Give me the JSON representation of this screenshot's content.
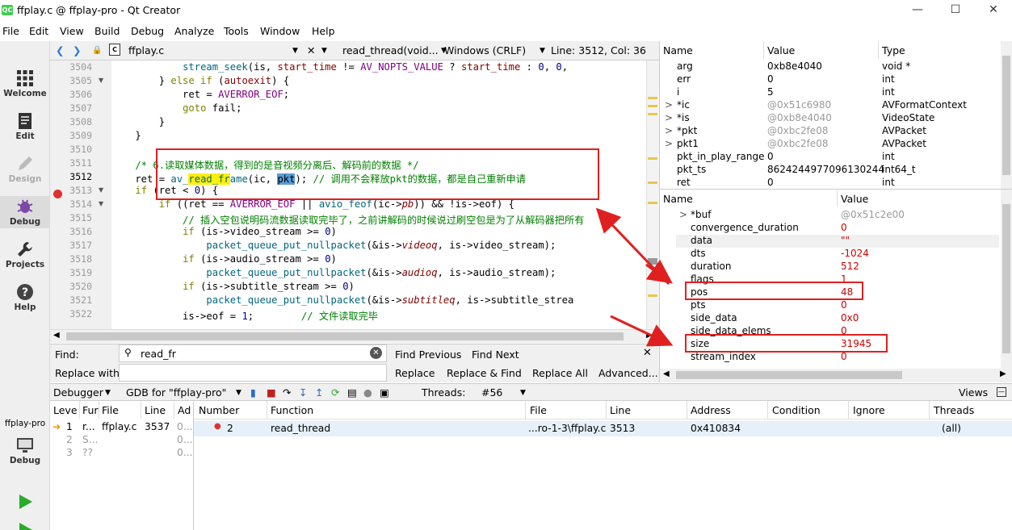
{
  "window": {
    "title": "ffplay.c @ ffplay-pro - Qt Creator",
    "logo": "QC"
  },
  "menu": [
    "File",
    "Edit",
    "View",
    "Build",
    "Debug",
    "Analyze",
    "Tools",
    "Window",
    "Help"
  ],
  "modes": [
    {
      "label": "Welcome",
      "icon": "welcome-grid-icon"
    },
    {
      "label": "Edit",
      "icon": "edit-document-icon"
    },
    {
      "label": "Design",
      "icon": "design-pen-icon"
    },
    {
      "label": "Debug",
      "icon": "debug-bug-icon"
    },
    {
      "label": "Projects",
      "icon": "wrench-icon"
    },
    {
      "label": "Help",
      "icon": "help-question-icon"
    }
  ],
  "kit": {
    "project": "ffplay-pro",
    "label": "Debug"
  },
  "editor": {
    "file": "ffplay.c",
    "function": "read_thread(void...",
    "line_ending": "Windows (CRLF)",
    "position": "Line: 3512, Col: 36"
  },
  "code": [
    {
      "n": "3504",
      "t": "            stream_seek(is, start_time != AV_NOPTS_VALUE ? start_time : 0, 0,"
    },
    {
      "n": "3505",
      "t": "        } else if (autoexit) {"
    },
    {
      "n": "3506",
      "t": "            ret = AVERROR_EOF;"
    },
    {
      "n": "3507",
      "t": "            goto fail;"
    },
    {
      "n": "3508",
      "t": "        }"
    },
    {
      "n": "3509",
      "t": "    }"
    },
    {
      "n": "3510",
      "t": ""
    },
    {
      "n": "3511",
      "t": "    /* 6.读取媒体数据，得到的是音视频分离后、解码前的数据 */"
    },
    {
      "n": "3512",
      "t": "    ret = av_read_frame(ic, pkt); // 调用不会释放pkt的数据，都是自己重新申请"
    },
    {
      "n": "3513",
      "t": "    if (ret < 0) {"
    },
    {
      "n": "3514",
      "t": "        if ((ret == AVERROR_EOF || avio_feof(ic->pb)) && !is->eof) {"
    },
    {
      "n": "3515",
      "t": "            // 插入空包说明码流数据读取完毕了，之前讲解码的时候说过刷空包是为了从解码器把所有"
    },
    {
      "n": "3516",
      "t": "            if (is->video_stream >= 0)"
    },
    {
      "n": "3517",
      "t": "                packet_queue_put_nullpacket(&is->videoq, is->video_stream);"
    },
    {
      "n": "3518",
      "t": "            if (is->audio_stream >= 0)"
    },
    {
      "n": "3519",
      "t": "                packet_queue_put_nullpacket(&is->audioq, is->audio_stream);"
    },
    {
      "n": "3520",
      "t": "            if (is->subtitle_stream >= 0)"
    },
    {
      "n": "3521",
      "t": "                packet_queue_put_nullpacket(&is->subtitleq, is->subtitle_strea"
    },
    {
      "n": "3522",
      "t": "            is->eof = 1;        // 文件读取完毕"
    }
  ],
  "find": {
    "find_label": "Find:",
    "find_value": "read_fr",
    "replace_label": "Replace with:",
    "replace_value": "",
    "find_previous": "Find Previous",
    "find_next": "Find Next",
    "replace": "Replace",
    "replace_find": "Replace & Find",
    "replace_all": "Replace All",
    "advanced": "Advanced..."
  },
  "locals_headers": [
    "Name",
    "Value",
    "Type"
  ],
  "locals": [
    {
      "name": "arg",
      "value": "0xb8e4040",
      "type": "void *",
      "exp": ""
    },
    {
      "name": "err",
      "value": "0",
      "type": "int",
      "exp": ""
    },
    {
      "name": "i",
      "value": "5",
      "type": "int",
      "exp": ""
    },
    {
      "name": "*ic",
      "value": "@0x51c6980",
      "type": "AVFormatContext",
      "exp": ">"
    },
    {
      "name": "*is",
      "value": "@0xb8e4040",
      "type": "VideoState",
      "exp": ">"
    },
    {
      "name": "*pkt",
      "value": "@0xbc2fe08",
      "type": "AVPacket",
      "exp": ">"
    },
    {
      "name": "pkt1",
      "value": "@0xbc2fe08",
      "type": "AVPacket",
      "exp": ">"
    },
    {
      "name": "pkt_in_play_range",
      "value": "0",
      "type": "int",
      "exp": ""
    },
    {
      "name": "pkt_ts",
      "value": "8624244977096130244",
      "type": "int64_t",
      "exp": ""
    },
    {
      "name": "ret",
      "value": "0",
      "type": "int",
      "exp": ""
    }
  ],
  "expr_headers": [
    "Name",
    "Value"
  ],
  "expr": [
    {
      "name": "*buf",
      "value": "@0x51c2e00",
      "exp": ">"
    },
    {
      "name": "convergence_duration",
      "value": "0",
      "exp": ""
    },
    {
      "name": "data",
      "value": "\"\"",
      "exp": ""
    },
    {
      "name": "dts",
      "value": "-1024",
      "exp": ""
    },
    {
      "name": "duration",
      "value": "512",
      "exp": ""
    },
    {
      "name": "flags",
      "value": "1",
      "exp": ""
    },
    {
      "name": "pos",
      "value": "48",
      "exp": ""
    },
    {
      "name": "pts",
      "value": "0",
      "exp": ""
    },
    {
      "name": "side_data",
      "value": "0x0",
      "exp": ""
    },
    {
      "name": "side_data_elems",
      "value": "0",
      "exp": ""
    },
    {
      "name": "size",
      "value": "31945",
      "exp": ""
    },
    {
      "name": "stream_index",
      "value": "0",
      "exp": ""
    }
  ],
  "debugger": {
    "label": "Debugger",
    "engine": "GDB for \"ffplay-pro\"",
    "threads_label": "Threads:",
    "thread": "#56",
    "views": "Views"
  },
  "stack_headers": [
    "Leve",
    "Fur",
    "File",
    "Line",
    "Ad"
  ],
  "stack": [
    {
      "level": "1",
      "fn": "r...",
      "file": "ffplay.c",
      "line": "3537",
      "addr": "0..."
    },
    {
      "level": "2",
      "fn": "S...",
      "file": "",
      "line": "",
      "addr": "0..."
    },
    {
      "level": "3",
      "fn": "??",
      "file": "",
      "line": "",
      "addr": "0..."
    }
  ],
  "bp_headers": [
    "Number",
    "Function",
    "File",
    "Line",
    "Address",
    "Condition",
    "Ignore",
    "Threads"
  ],
  "breakpoints": [
    {
      "number": "2",
      "function": "read_thread",
      "file": "...ro-1-3\\ffplay.c",
      "line": "3513",
      "address": "0x410834",
      "condition": "",
      "ignore": "",
      "threads": "(all)"
    }
  ],
  "colors": {
    "accent": "#e02020",
    "highlight": "#ffef0b",
    "selection": "#5b9bd5",
    "breakpoint": "#e03030"
  }
}
